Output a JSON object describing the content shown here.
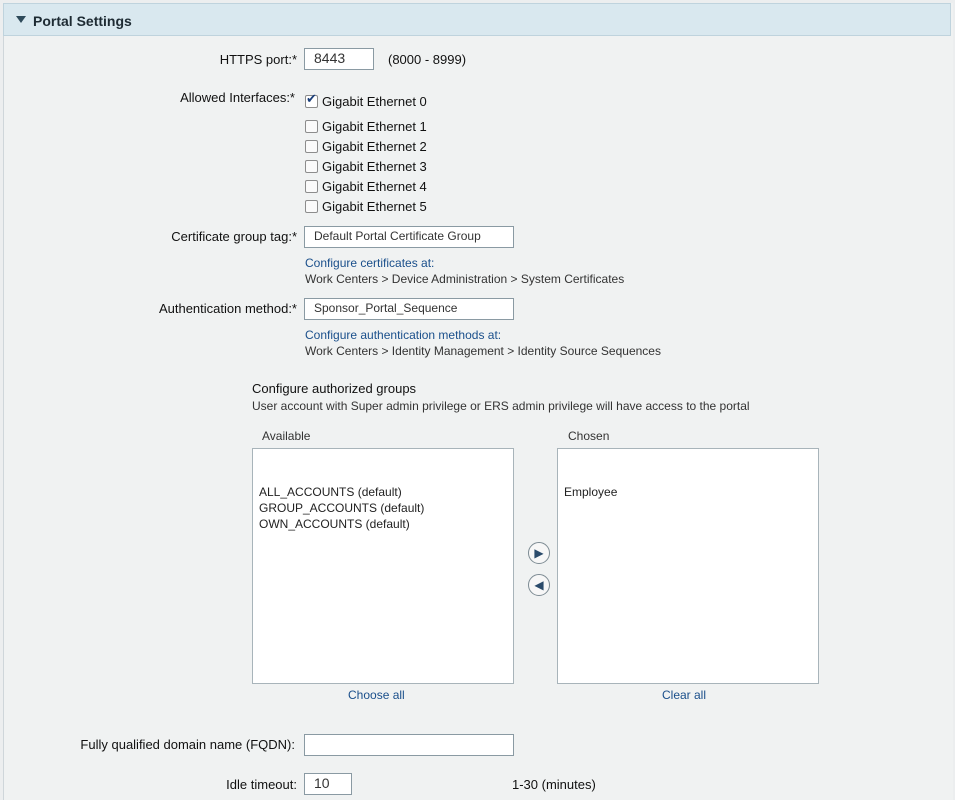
{
  "section": {
    "title": "Portal Settings"
  },
  "https_port": {
    "label": "HTTPS port:*",
    "value": "8443",
    "range": "(8000 - 8999)"
  },
  "interfaces": {
    "label": "Allowed Interfaces:*",
    "items": [
      {
        "label": "Gigabit Ethernet 0",
        "checked": true
      },
      {
        "label": "Gigabit Ethernet 1",
        "checked": false
      },
      {
        "label": "Gigabit Ethernet 2",
        "checked": false
      },
      {
        "label": "Gigabit Ethernet 3",
        "checked": false
      },
      {
        "label": "Gigabit Ethernet 4",
        "checked": false
      },
      {
        "label": "Gigabit Ethernet 5",
        "checked": false
      }
    ]
  },
  "certificate": {
    "label": "Certificate group tag:*",
    "value": "Default Portal Certificate Group",
    "link": "Configure certificates at:",
    "path": "Work Centers > Device Administration > System Certificates"
  },
  "auth_method": {
    "label": "Authentication method:*",
    "value": "Sponsor_Portal_Sequence",
    "link": "Configure authentication methods at:",
    "path": "Work Centers > Identity Management > Identity Source Sequences"
  },
  "groups": {
    "title": "Configure authorized groups",
    "note": "User account with Super admin privilege or ERS admin privilege will have access to the portal",
    "available_label": "Available",
    "chosen_label": "Chosen",
    "available_items": [
      "ALL_ACCOUNTS (default)",
      "GROUP_ACCOUNTS (default)",
      "OWN_ACCOUNTS (default)"
    ],
    "chosen_items": [
      "Employee"
    ],
    "move_all": "Choose all",
    "clear_all": "Clear all"
  },
  "fqdn": {
    "label": "Fully qualified domain name (FQDN):"
  },
  "idle_timeout": {
    "label": "Idle timeout:",
    "value": "10",
    "unit": "1-30 (minutes)"
  }
}
